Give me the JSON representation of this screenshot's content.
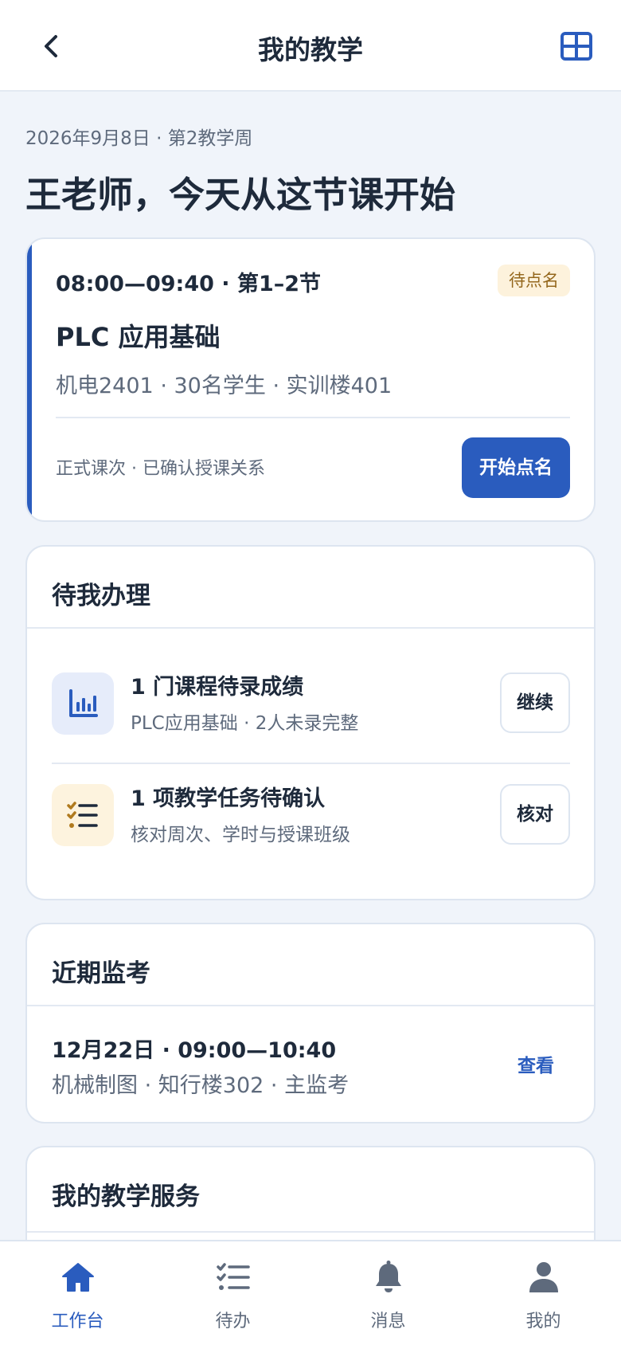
{
  "header": {
    "title": "我的教学",
    "back_icon": "chevron-left-icon",
    "grid_icon": "grid-icon"
  },
  "summary": {
    "date": "2026年9月8日",
    "week": "第2教学周",
    "greeting": "王老师，今天从这节课开始"
  },
  "current_class": {
    "time": "08:00—09:40",
    "period": "第1–2节",
    "status": "待点名",
    "course": "PLC 应用基础",
    "class_name": "机电2401",
    "students": "30名学生",
    "location": "实训楼401",
    "type": "正式课次",
    "relation": "已确认授课关系",
    "action_label": "开始点名"
  },
  "todos": {
    "title": "待我办理",
    "items": [
      {
        "icon": "bar-chart-icon",
        "title": "1 门课程待录成绩",
        "sub_course": "PLC应用基础",
        "sub_detail": "2人未录完整",
        "action_label": "继续"
      },
      {
        "icon": "checklist-icon",
        "title": "1 项教学任务待确认",
        "sub": "核对周次、学时与授课班级",
        "action_label": "核对"
      }
    ]
  },
  "exam": {
    "title": "近期监考",
    "date": "12月22日",
    "time": "09:00—10:40",
    "subject": "机械制图",
    "location": "知行楼302",
    "role": "主监考",
    "action_label": "查看"
  },
  "services": {
    "title": "我的教学服务"
  },
  "bottom_nav": {
    "items": [
      {
        "label": "工作台",
        "icon": "home-icon",
        "active": true
      },
      {
        "label": "待办",
        "icon": "checklist-icon",
        "active": false
      },
      {
        "label": "消息",
        "icon": "bell-icon",
        "active": false
      },
      {
        "label": "我的",
        "icon": "user-icon",
        "active": false
      }
    ]
  },
  "colors": {
    "accent": "#2a5cbe",
    "text": "#1e2a3b",
    "muted": "#5e6a7c",
    "background": "#f0f4fa",
    "badge_bg": "#fdf2dc",
    "badge_text": "#94671c"
  }
}
